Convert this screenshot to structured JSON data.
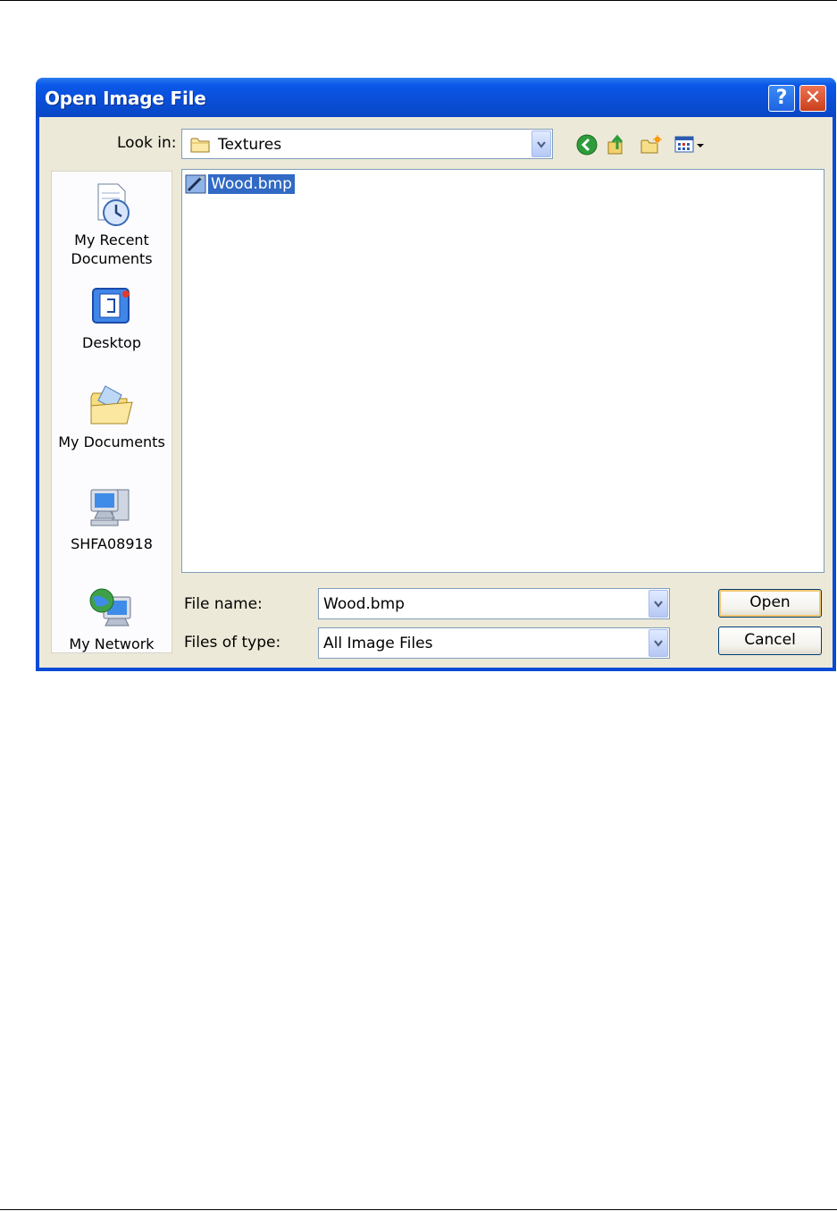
{
  "dialog": {
    "title": "Open Image File",
    "help_label": "?",
    "close_label": "✕"
  },
  "look_in": {
    "label": "Look in:",
    "value": "Textures"
  },
  "places": [
    {
      "label": "My Recent\nDocuments",
      "icon": "recent-documents-icon"
    },
    {
      "label": "Desktop",
      "icon": "desktop-icon"
    },
    {
      "label": "My Documents",
      "icon": "my-documents-icon"
    },
    {
      "label": "SHFA08918",
      "icon": "my-computer-icon"
    },
    {
      "label": "My Network",
      "icon": "my-network-icon"
    }
  ],
  "files": [
    {
      "name": "Wood.bmp",
      "selected": true
    }
  ],
  "file_name": {
    "label": "File name:",
    "value": "Wood.bmp"
  },
  "file_type": {
    "label": "Files of type:",
    "value": "All Image Files"
  },
  "buttons": {
    "open": "Open",
    "cancel": "Cancel"
  },
  "colors": {
    "titlebar": "#0a4ad6",
    "dialog_face": "#ece9d8",
    "selection": "#316ac5"
  }
}
